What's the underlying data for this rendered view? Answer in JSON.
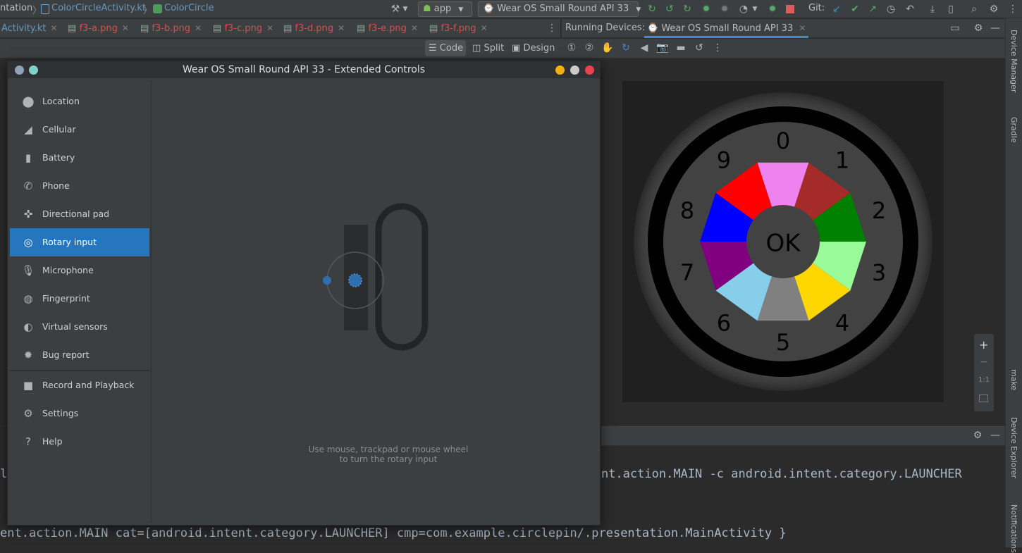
{
  "topbar": {
    "breadcrumb_1": "ntation",
    "breadcrumb_2": "ColorCircleActivity.kt",
    "breadcrumb_3": "ColorCircle",
    "run_config": "app",
    "device_combo": "Wear OS Small Round API 33",
    "git_label": "Git:"
  },
  "file_tabs": [
    {
      "label": "Activity.kt"
    },
    {
      "label": "f3-a.png"
    },
    {
      "label": "f3-b.png"
    },
    {
      "label": "f3-c.png"
    },
    {
      "label": "f3-d.png"
    },
    {
      "label": "f3-e.png"
    },
    {
      "label": "f3-f.png"
    }
  ],
  "running_devices": {
    "label": "Running Devices:",
    "tab": "Wear OS Small Round API 33"
  },
  "view_modes": {
    "code": "Code",
    "split": "Split",
    "design": "Design"
  },
  "dialog": {
    "title": "Wear OS Small Round API 33 - Extended Controls",
    "nav": [
      {
        "label": "Location",
        "icon": "location-pin-icon"
      },
      {
        "label": "Cellular",
        "icon": "signal-icon"
      },
      {
        "label": "Battery",
        "icon": "battery-icon"
      },
      {
        "label": "Phone",
        "icon": "phone-icon"
      },
      {
        "label": "Directional pad",
        "icon": "dpad-icon"
      },
      {
        "label": "Rotary input",
        "icon": "rotary-icon",
        "selected": true
      },
      {
        "label": "Microphone",
        "icon": "microphone-icon"
      },
      {
        "label": "Fingerprint",
        "icon": "fingerprint-icon"
      },
      {
        "label": "Virtual sensors",
        "icon": "sensors-icon"
      },
      {
        "label": "Bug report",
        "icon": "bug-icon"
      },
      {
        "label": "Record and Playback",
        "icon": "video-camera-icon"
      },
      {
        "label": "Settings",
        "icon": "gear-icon"
      },
      {
        "label": "Help",
        "icon": "help-icon"
      }
    ],
    "hint_line1": "Use mouse, trackpad or mouse wheel",
    "hint_line2": "to turn the rotary input"
  },
  "watch": {
    "center_label": "OK",
    "numbers": [
      "0",
      "1",
      "2",
      "3",
      "4",
      "5",
      "6",
      "7",
      "8",
      "9"
    ],
    "segment_colors": [
      "#ee82ee",
      "#a52a2a",
      "#008000",
      "#98fb98",
      "#ffd700",
      "#808080",
      "#87ceeb",
      "#800080",
      "#0000ff",
      "#ff0000"
    ]
  },
  "zoom": {
    "plus": "+",
    "minus": "−",
    "one_to_one": "1:1"
  },
  "side_tools": {
    "device_manager": "Device Manager",
    "gradle": "Gradle",
    "make": "make",
    "device_explorer": "Device Explorer",
    "notifications": "Notifications"
  },
  "console": {
    "line1_left": "l",
    "line1_right": "nt.action.MAIN -c android.intent.category.LAUNCHER",
    "line2": "ent.action.MAIN cat=[android.intent.category.LAUNCHER] cmp=com.example.circlepin/.presentation.MainActivity }"
  }
}
